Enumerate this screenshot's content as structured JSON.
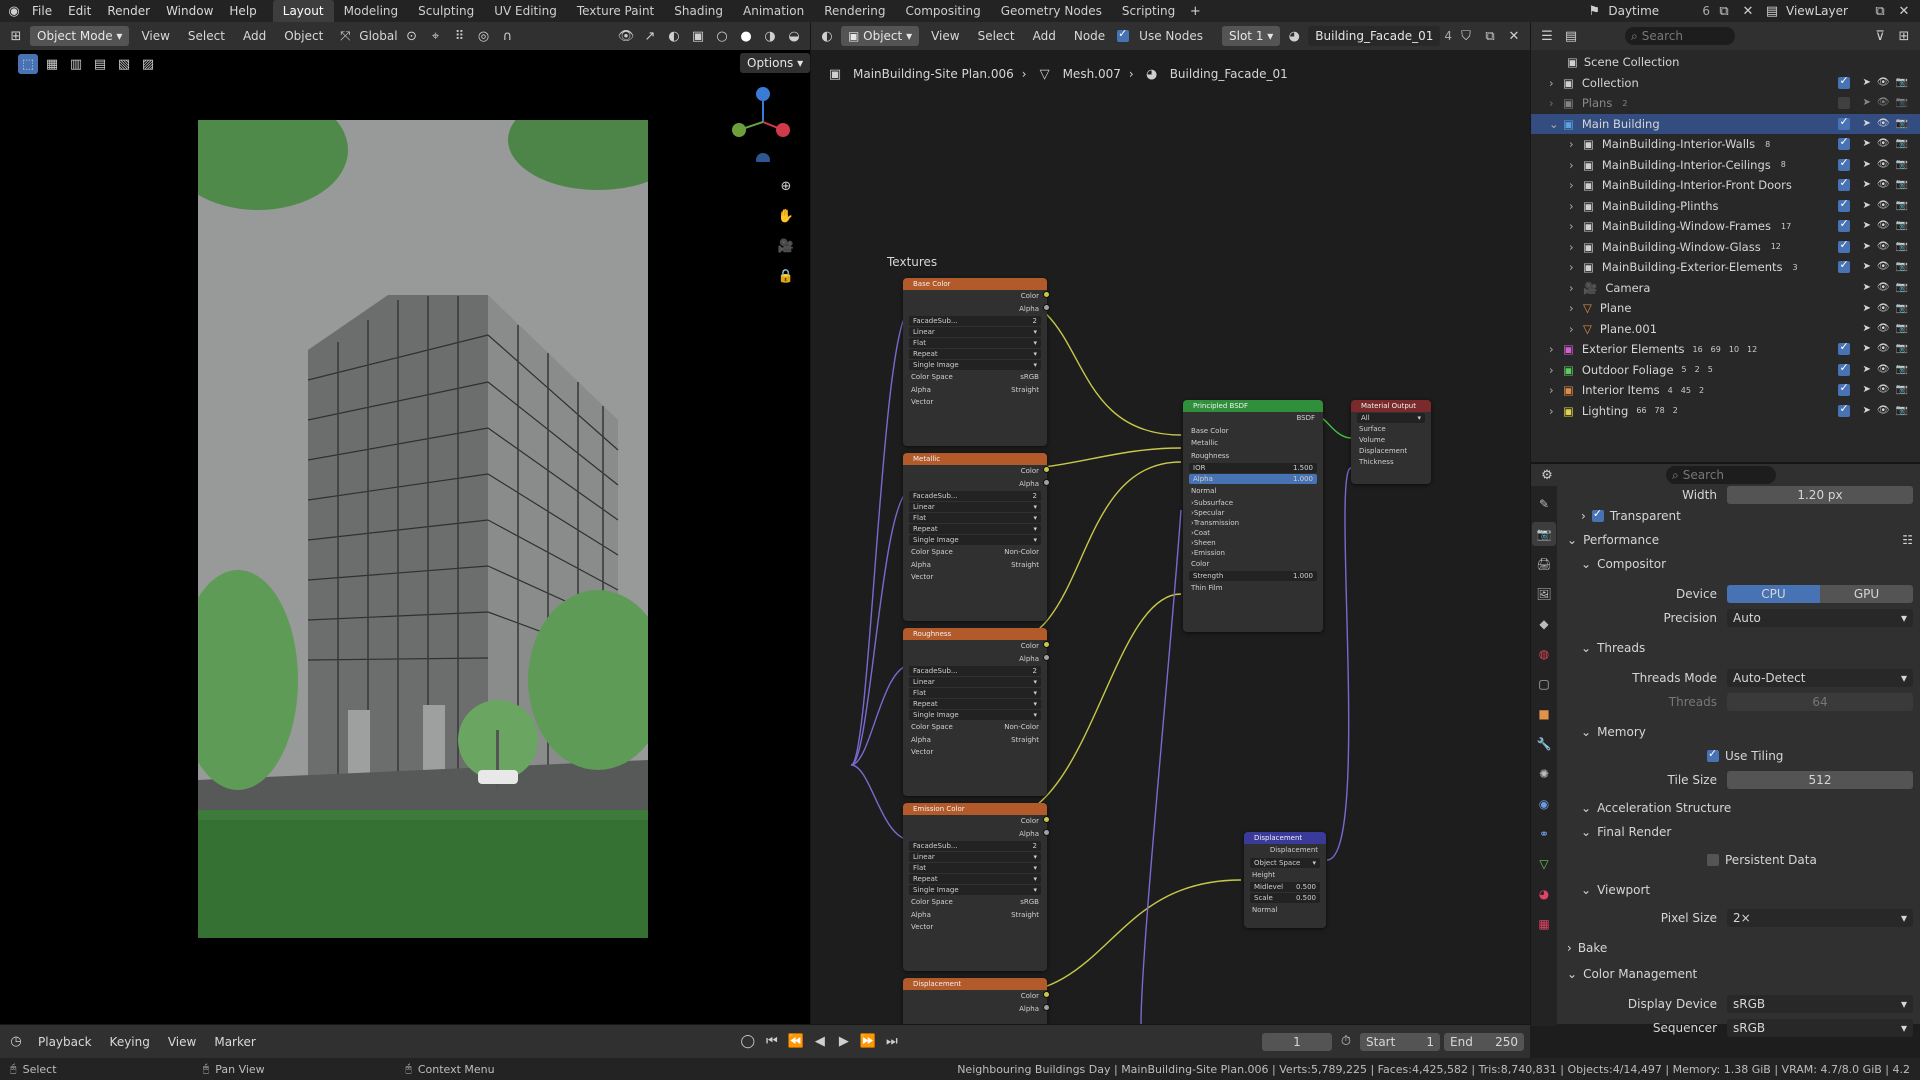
{
  "topbar": {
    "menus": [
      "File",
      "Edit",
      "Render",
      "Window",
      "Help"
    ],
    "workspaces": [
      "Layout",
      "Modeling",
      "Sculpting",
      "UV Editing",
      "Texture Paint",
      "Shading",
      "Animation",
      "Rendering",
      "Compositing",
      "Geometry Nodes",
      "Scripting"
    ],
    "active_workspace": "Layout",
    "scene": "Daytime",
    "scene_users": "6",
    "view_layer": "ViewLayer"
  },
  "viewport": {
    "mode": "Object Mode",
    "menus": [
      "View",
      "Select",
      "Add",
      "Object"
    ],
    "orientation": "Global",
    "options_label": "Options"
  },
  "node_editor": {
    "type": "Object",
    "menus": [
      "View",
      "Select",
      "Add",
      "Node"
    ],
    "use_nodes_label": "Use Nodes",
    "slot": "Slot 1",
    "material": "Building_Facade_01",
    "material_users": "4",
    "breadcrumb": [
      "MainBuilding-Site Plan.006",
      "Mesh.007",
      "Building_Facade_01"
    ],
    "frame_label": "Textures",
    "texture_nodes": [
      {
        "title": "Base Color",
        "image": "FacadeSub...",
        "users": "2",
        "interp": "Linear",
        "proj": "Flat",
        "ext": "Repeat",
        "src": "Single Image",
        "colorspace": "sRGB",
        "alpha": "Straight"
      },
      {
        "title": "Metallic",
        "image": "FacadeSub...",
        "users": "2",
        "interp": "Linear",
        "proj": "Flat",
        "ext": "Repeat",
        "src": "Single Image",
        "colorspace": "Non-Color",
        "alpha": "Straight"
      },
      {
        "title": "Roughness",
        "image": "FacadeSub...",
        "users": "2",
        "interp": "Linear",
        "proj": "Flat",
        "ext": "Repeat",
        "src": "Single Image",
        "colorspace": "Non-Color",
        "alpha": "Straight"
      },
      {
        "title": "Emission Color",
        "image": "FacadeSub...",
        "users": "2",
        "interp": "Linear",
        "proj": "Flat",
        "ext": "Repeat",
        "src": "Single Image",
        "colorspace": "sRGB",
        "alpha": "Straight"
      },
      {
        "title": "Displacement",
        "image": "",
        "users": "",
        "interp": "",
        "proj": "",
        "ext": "",
        "src": "",
        "colorspace": "",
        "alpha": ""
      }
    ],
    "sock_color": "Color",
    "sock_alpha": "Alpha",
    "sock_vector": "Vector",
    "lbl_colorspace": "Color Space",
    "lbl_alpha": "Alpha",
    "bsdf": {
      "title": "Principled BSDF",
      "out": "BSDF",
      "rows": [
        "Base Color",
        "Metallic",
        "Roughness"
      ],
      "ior_label": "IOR",
      "ior": "1.500",
      "alpha_label": "Alpha",
      "alpha": "1.000",
      "normal": "Normal",
      "panels": [
        "Subsurface",
        "Specular",
        "Transmission",
        "Coat",
        "Sheen",
        "Emission"
      ],
      "emission_color": "Color",
      "strength_label": "Strength",
      "strength": "1.000",
      "thin_film": "Thin Film"
    },
    "output": {
      "title": "Material Output",
      "target": "All",
      "sockets": [
        "Surface",
        "Volume",
        "Displacement",
        "Thickness"
      ]
    },
    "displacement": {
      "title": "Displacement",
      "out": "Displacement",
      "space": "Object Space",
      "height": "Height",
      "midlevel_label": "Midlevel",
      "midlevel": "0.500",
      "scale_label": "Scale",
      "scale": "0.500",
      "normal": "Normal"
    }
  },
  "outliner": {
    "search_placeholder": "Search",
    "root": "Scene Collection",
    "items": [
      {
        "label": "Collection",
        "depth": 0,
        "kind": "collection",
        "color": "#cfcfcf"
      },
      {
        "label": "Plans",
        "depth": 0,
        "kind": "collection",
        "color": "#cfcfcf",
        "dim": true,
        "badge": "2"
      },
      {
        "label": "Main Building",
        "depth": 0,
        "kind": "collection",
        "color": "#5aa2e0",
        "expanded": true
      },
      {
        "label": "MainBuilding-Interior-Walls",
        "depth": 1,
        "kind": "collection",
        "color": "#cfcfcf",
        "badge": "8"
      },
      {
        "label": "MainBuilding-Interior-Ceilings",
        "depth": 1,
        "kind": "collection",
        "color": "#cfcfcf",
        "badge": "8"
      },
      {
        "label": "MainBuilding-Interior-Front Doors",
        "depth": 1,
        "kind": "collection",
        "color": "#cfcfcf"
      },
      {
        "label": "MainBuilding-Plinths",
        "depth": 1,
        "kind": "collection",
        "color": "#cfcfcf"
      },
      {
        "label": "MainBuilding-Window-Frames",
        "depth": 1,
        "kind": "collection",
        "color": "#cfcfcf",
        "badge": "17"
      },
      {
        "label": "MainBuilding-Window-Glass",
        "depth": 1,
        "kind": "collection",
        "color": "#cfcfcf",
        "badge": "12"
      },
      {
        "label": "MainBuilding-Exterior-Elements",
        "depth": 1,
        "kind": "collection",
        "color": "#cfcfcf",
        "badge": "3"
      },
      {
        "label": "Camera",
        "depth": 1,
        "kind": "camera",
        "color": "#e0924a"
      },
      {
        "label": "Plane",
        "depth": 1,
        "kind": "mesh",
        "color": "#e0924a"
      },
      {
        "label": "Plane.001",
        "depth": 1,
        "kind": "mesh",
        "color": "#e0924a"
      },
      {
        "label": "Exterior Elements",
        "depth": 0,
        "kind": "collection",
        "color": "#d15fd1",
        "badges": [
          "16",
          "69",
          "10",
          "12"
        ]
      },
      {
        "label": "Outdoor Foliage",
        "depth": 0,
        "kind": "collection",
        "color": "#5ec95e",
        "badges": [
          "5",
          "2",
          "5"
        ]
      },
      {
        "label": "Interior Items",
        "depth": 0,
        "kind": "collection",
        "color": "#e08a4a",
        "badges": [
          "4",
          "45",
          "2"
        ]
      },
      {
        "label": "Lighting",
        "depth": 0,
        "kind": "collection",
        "color": "#e0d04a",
        "badges": [
          "66",
          "78",
          "2"
        ]
      }
    ]
  },
  "properties": {
    "search_placeholder": "Search",
    "width_label": "Width",
    "width_value": "1.20 px",
    "transparent_label": "Transparent",
    "performance": "Performance",
    "compositor": "Compositor",
    "device_label": "Device",
    "device_cpu": "CPU",
    "device_gpu": "GPU",
    "precision_label": "Precision",
    "precision": "Auto",
    "threads": "Threads",
    "threads_mode_label": "Threads Mode",
    "threads_mode": "Auto-Detect",
    "threads_label": "Threads",
    "threads_value": "64",
    "memory": "Memory",
    "use_tiling": "Use Tiling",
    "tile_size_label": "Tile Size",
    "tile_size": "512",
    "accel": "Acceleration Structure",
    "final_render": "Final Render",
    "persistent_data": "Persistent Data",
    "viewport": "Viewport",
    "pixel_size_label": "Pixel Size",
    "pixel_size": "2×",
    "bake": "Bake",
    "color_management": "Color Management",
    "display_device_label": "Display Device",
    "display_device": "sRGB",
    "sequencer_label": "Sequencer",
    "sequencer": "sRGB"
  },
  "timeline": {
    "menus": [
      "Playback",
      "Keying",
      "View",
      "Marker"
    ],
    "current_frame": "1",
    "start_label": "Start",
    "start": "1",
    "end_label": "End",
    "end": "250"
  },
  "statusbar": {
    "select": "Select",
    "pan": "Pan View",
    "context": "Context Menu",
    "info": "Neighbouring Buildings Day | MainBuilding-Site Plan.006 | Verts:5,789,225 | Faces:4,425,582 | Tris:8,740,831 | Objects:4/14,497 | Memory: 1.38 GiB | VRAM: 4.7/8.0 GiB | 4.2"
  },
  "colors": {
    "accent": "#4772b3",
    "node_texture": "#b35a2a",
    "node_shader": "#2f8f3a",
    "node_output": "#7a2a2a",
    "node_vector": "#3a3a9a",
    "link_yellow": "#c8c84a",
    "link_purple": "#7a6ad0"
  }
}
